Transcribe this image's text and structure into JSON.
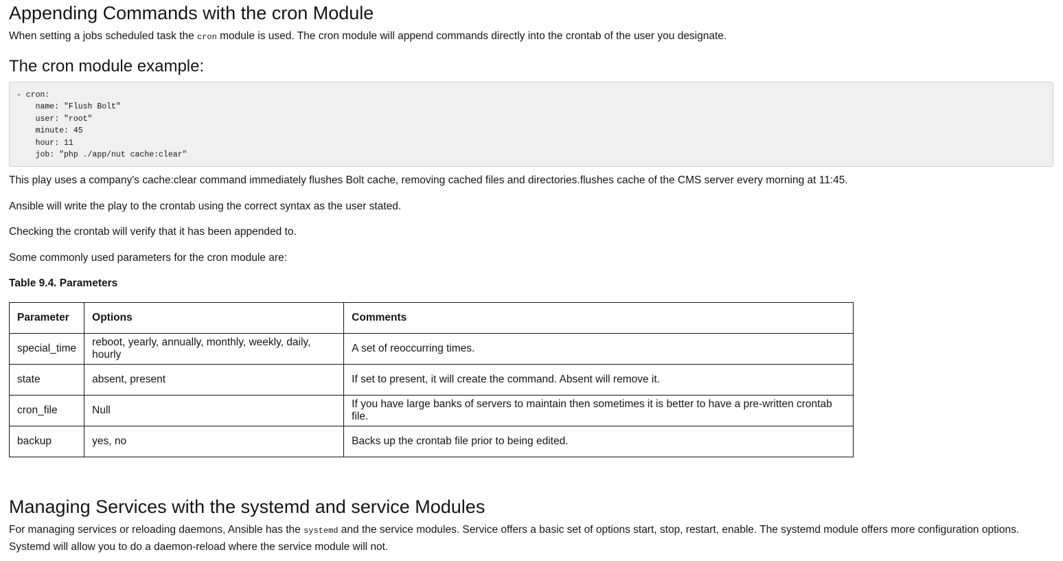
{
  "section1": {
    "title": "Appending Commands with the cron Module",
    "intro_before": "When setting a jobs scheduled task the ",
    "intro_code": "cron",
    "intro_after": " module is used. The cron module will append commands directly into the crontab of the user you designate."
  },
  "example": {
    "title": "The cron module example:",
    "code": "- cron:\n    name: \"Flush Bolt\"\n    user: \"root\"\n    minute: 45\n    hour: 11\n    job: \"php ./app/nut cache:clear\""
  },
  "paragraphs": [
    "This play uses a company's cache:clear command immediately flushes Bolt cache, removing cached files and directories.flushes cache of the CMS server every morning at 11:45.",
    "Ansible will write the play to the crontab using the correct syntax as the user stated.",
    "Checking the crontab will verify that it has been appended to.",
    "Some commonly used parameters for the cron module are:"
  ],
  "table": {
    "caption": "Table 9.4. Parameters",
    "headers": [
      "Parameter",
      "Options",
      "Comments"
    ],
    "rows": [
      [
        "special_time",
        "reboot, yearly, annually, monthly, weekly, daily, hourly",
        "A set of reoccurring times."
      ],
      [
        "state",
        "absent, present",
        "If set to present, it will create the command. Absent will remove it."
      ],
      [
        "cron_file",
        "Null",
        "If you have large banks of servers to maintain then sometimes it is better to have a pre-written crontab file."
      ],
      [
        "backup",
        "yes, no",
        "Backs up the crontab file prior to being edited."
      ]
    ]
  },
  "section2": {
    "title": "Managing Services with the systemd and service Modules",
    "text_before": "For managing services or reloading daemons, Ansible has the ",
    "text_code": "systemd",
    "text_after": " and the service modules. Service offers a basic set of options start, stop, restart, enable. The systemd module offers more configuration options. Systemd will allow you to do a daemon-reload where the service module will not."
  }
}
